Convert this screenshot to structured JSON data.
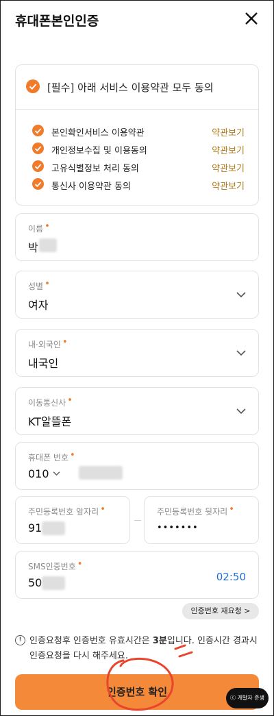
{
  "header": {
    "title": "휴대폰본인인증",
    "close_icon": "close-icon"
  },
  "agreement": {
    "all_label": "[필수] 아래 서비스 이용약관 모두 동의",
    "terms": [
      {
        "label": "본인확인서비스 이용약관",
        "view": "약관보기"
      },
      {
        "label": "개인정보수집 및 이용동의",
        "view": "약관보기"
      },
      {
        "label": "고유식별정보 처리 동의",
        "view": "약관보기"
      },
      {
        "label": "통신사 이용약관 동의",
        "view": "약관보기"
      }
    ]
  },
  "form": {
    "name": {
      "label": "이름",
      "value": "박"
    },
    "gender": {
      "label": "성별",
      "value": "여자"
    },
    "nationality": {
      "label": "내·외국인",
      "value": "내국인"
    },
    "carrier": {
      "label": "이동통신사",
      "value": "KT알뜰폰"
    },
    "phone": {
      "label": "휴대폰 번호",
      "prefix": "010"
    },
    "rrn_front": {
      "label": "주민등록번호 앞자리",
      "value": "91"
    },
    "rrn_back": {
      "label": "주민등록번호 뒷자리",
      "value": "•••••••"
    },
    "sms": {
      "label": "SMS인증번호",
      "value": "50",
      "timer": "02:50"
    }
  },
  "resend_label": "인증번호 재요청 >",
  "notice": {
    "before": "인증요청후 인증번호 유효시간은 ",
    "bold": "3분",
    "after": "입니다. 인증시간 경과시 인증요청을 다시 해주세요."
  },
  "confirm_label": "인증번호 확인",
  "watermark": "ⓒ 개발자 준생",
  "colors": {
    "accent": "#f07b2b",
    "button": "#f5893a",
    "timer": "#1f6fd1",
    "term_link": "#b07a1a"
  }
}
